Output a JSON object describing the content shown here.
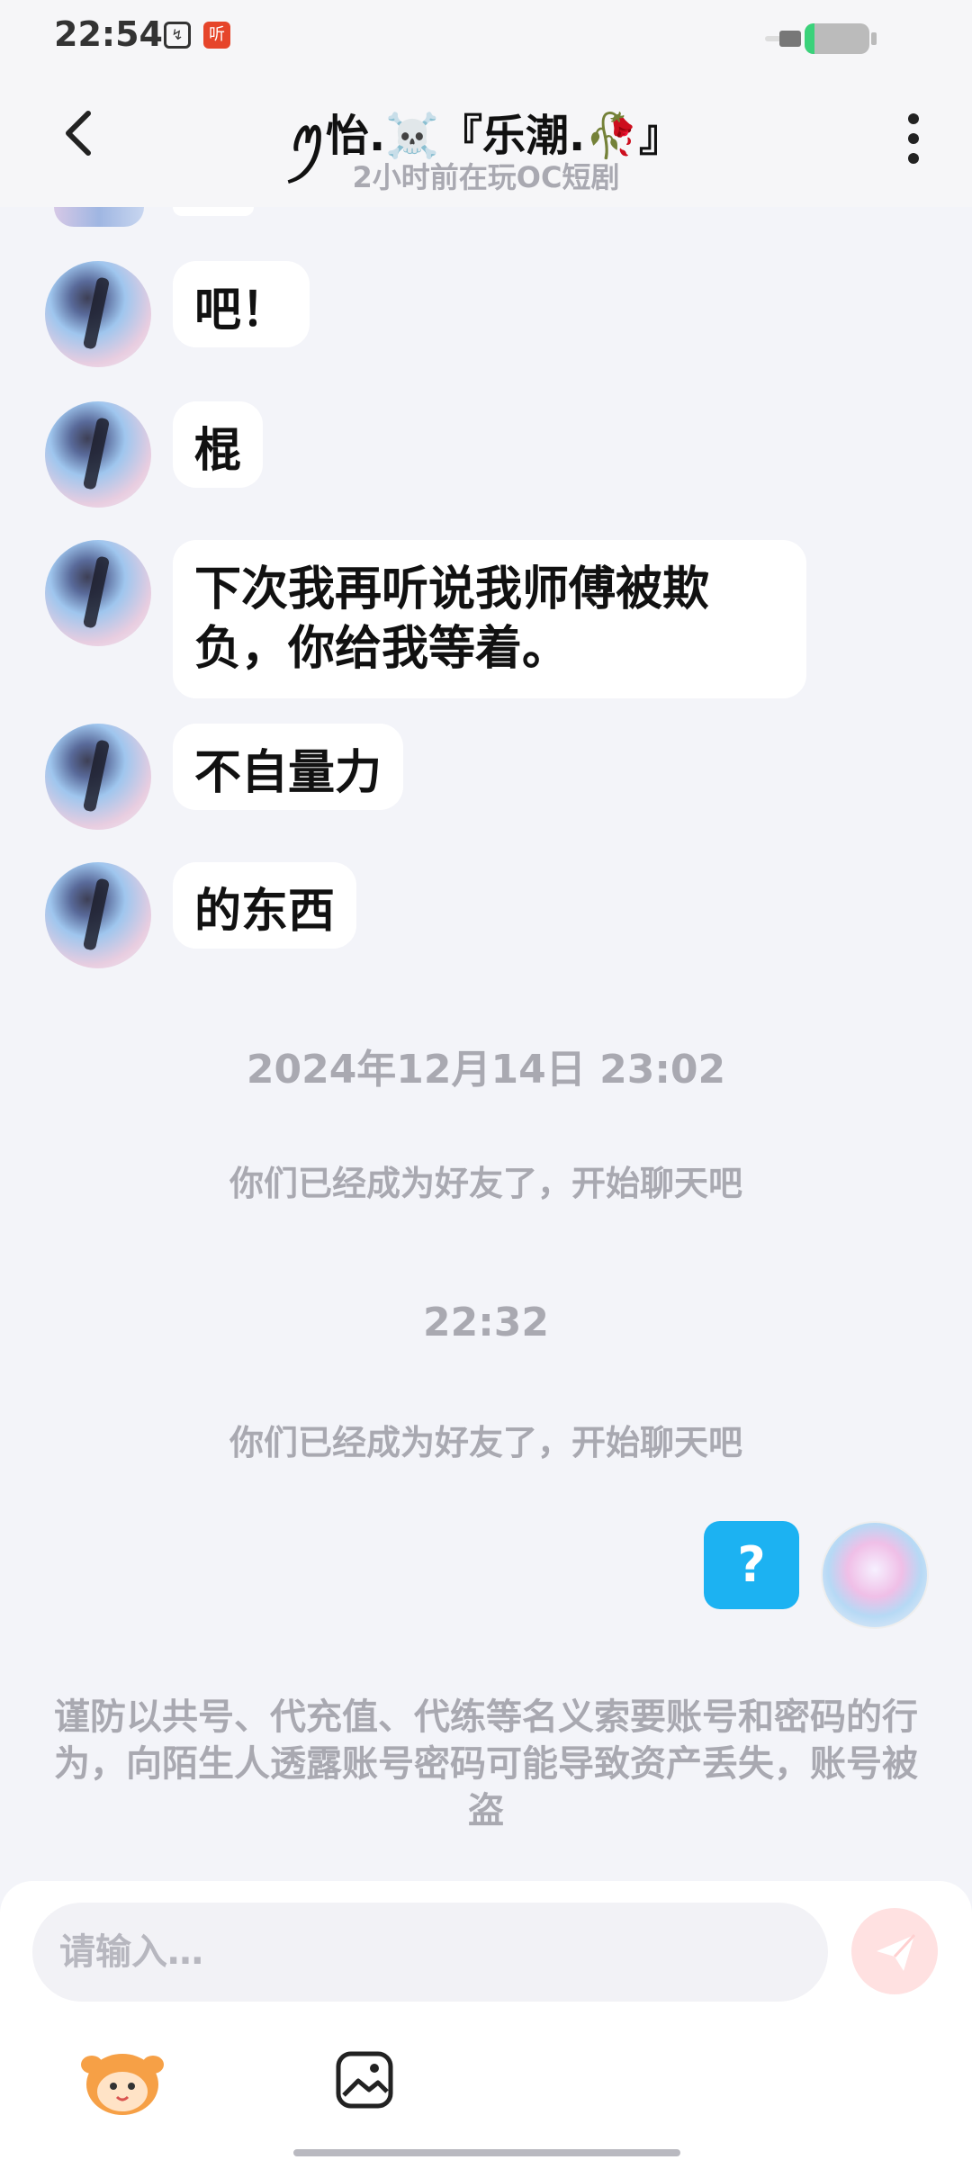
{
  "status_bar": {
    "time": "22:54",
    "app_icon_a": "↯",
    "app_icon_b": "听",
    "battery_level": 0.15
  },
  "header": {
    "title": "ꪑ怡.☠️『乐潮.🥀』",
    "subtitle": "2小时前在玩OC短剧"
  },
  "messages": [
    {
      "side": "left",
      "text": "吧！"
    },
    {
      "side": "left",
      "text": "棍"
    },
    {
      "side": "left",
      "text": "下次我再听说我师傅被欺负，你给我等着。"
    },
    {
      "side": "left",
      "text": "不自量力"
    },
    {
      "side": "left",
      "text": "的东西"
    }
  ],
  "timestamps": {
    "first": "2024年12月14日 23:02",
    "second": "22:32"
  },
  "system_messages": {
    "friend_1": "你们已经成为好友了，开始聊天吧",
    "friend_2": "你们已经成为好友了，开始聊天吧"
  },
  "my_message": {
    "text": "?"
  },
  "warning": "谨防以共号、代充值、代练等名义索要账号和密码的行为，向陌生人透露账号密码可能导致资产丢失，账号被盗",
  "input": {
    "placeholder": "请输入…"
  },
  "colors": {
    "accent_blue": "#1cb2f2",
    "send_disabled": "#ffe1e1",
    "muted_text": "#a9a9b1"
  },
  "icons": [
    "back-arrow-icon",
    "more-vert-icon",
    "send-icon",
    "mascot-icon",
    "image-icon"
  ]
}
